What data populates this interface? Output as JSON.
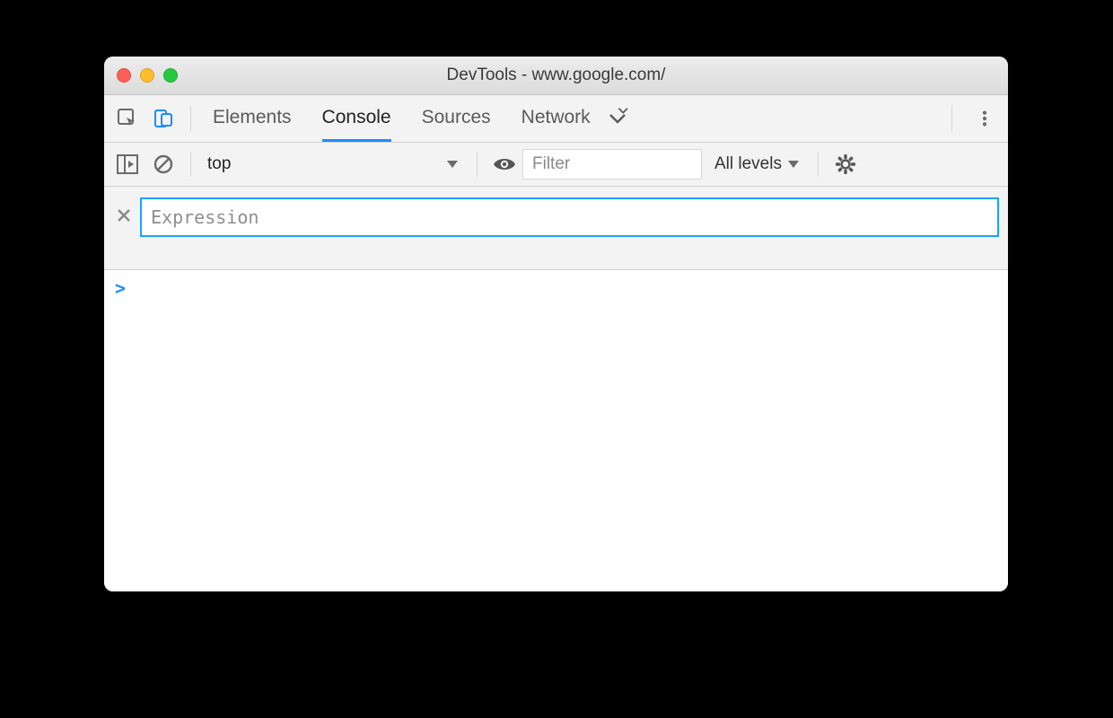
{
  "window": {
    "title": "DevTools - www.google.com/"
  },
  "tabs": {
    "items": [
      "Elements",
      "Console",
      "Sources",
      "Network"
    ],
    "active": "Console"
  },
  "console_toolbar": {
    "context": "top",
    "filter_placeholder": "Filter",
    "levels_label": "All levels"
  },
  "live_expression": {
    "placeholder": "Expression",
    "value": ""
  },
  "prompt": ">"
}
